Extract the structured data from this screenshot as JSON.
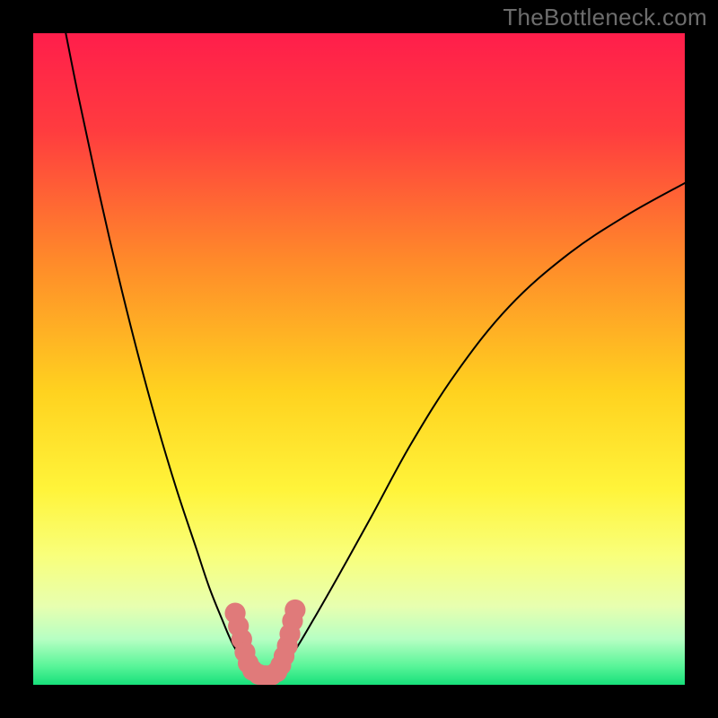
{
  "watermark": "TheBottleneck.com",
  "chart_data": {
    "type": "line",
    "title": "",
    "xlabel": "",
    "ylabel": "",
    "xlim": [
      0,
      100
    ],
    "ylim": [
      0,
      100
    ],
    "gradient_stops": [
      {
        "offset": 0.0,
        "color": "#ff1e4b"
      },
      {
        "offset": 0.15,
        "color": "#ff3c3f"
      },
      {
        "offset": 0.35,
        "color": "#ff8a2a"
      },
      {
        "offset": 0.55,
        "color": "#ffd21f"
      },
      {
        "offset": 0.7,
        "color": "#fff43a"
      },
      {
        "offset": 0.8,
        "color": "#f9ff7a"
      },
      {
        "offset": 0.88,
        "color": "#e7ffb0"
      },
      {
        "offset": 0.93,
        "color": "#b6ffc3"
      },
      {
        "offset": 0.97,
        "color": "#5cf59a"
      },
      {
        "offset": 1.0,
        "color": "#17e07a"
      }
    ],
    "series": [
      {
        "name": "left-curve",
        "kind": "curve",
        "x": [
          5,
          7,
          10,
          13,
          16,
          19,
          22,
          25,
          27,
          29,
          30.5,
          32,
          33.5
        ],
        "y": [
          100,
          90,
          76,
          63,
          51,
          40,
          30,
          21,
          15,
          10,
          6.5,
          4,
          2.5
        ]
      },
      {
        "name": "right-curve",
        "kind": "curve",
        "x": [
          38,
          40,
          43,
          47,
          52,
          58,
          65,
          73,
          82,
          91,
          100
        ],
        "y": [
          2.5,
          5,
          10,
          17,
          26,
          37,
          48,
          58,
          66,
          72,
          77
        ]
      },
      {
        "name": "valley-marker",
        "kind": "marker-path",
        "color": "#e07a7a",
        "width": 3.2,
        "points": [
          {
            "x": 31.0,
            "y": 11.0
          },
          {
            "x": 31.5,
            "y": 9.0
          },
          {
            "x": 32.0,
            "y": 7.0
          },
          {
            "x": 32.5,
            "y": 5.0
          },
          {
            "x": 33.0,
            "y": 3.3
          },
          {
            "x": 33.7,
            "y": 2.2
          },
          {
            "x": 34.6,
            "y": 1.6
          },
          {
            "x": 35.6,
            "y": 1.4
          },
          {
            "x": 36.6,
            "y": 1.5
          },
          {
            "x": 37.4,
            "y": 2.0
          },
          {
            "x": 38.0,
            "y": 3.0
          },
          {
            "x": 38.5,
            "y": 4.4
          },
          {
            "x": 39.0,
            "y": 6.0
          },
          {
            "x": 39.4,
            "y": 7.8
          },
          {
            "x": 39.8,
            "y": 9.8
          },
          {
            "x": 40.2,
            "y": 11.5
          }
        ]
      }
    ]
  }
}
